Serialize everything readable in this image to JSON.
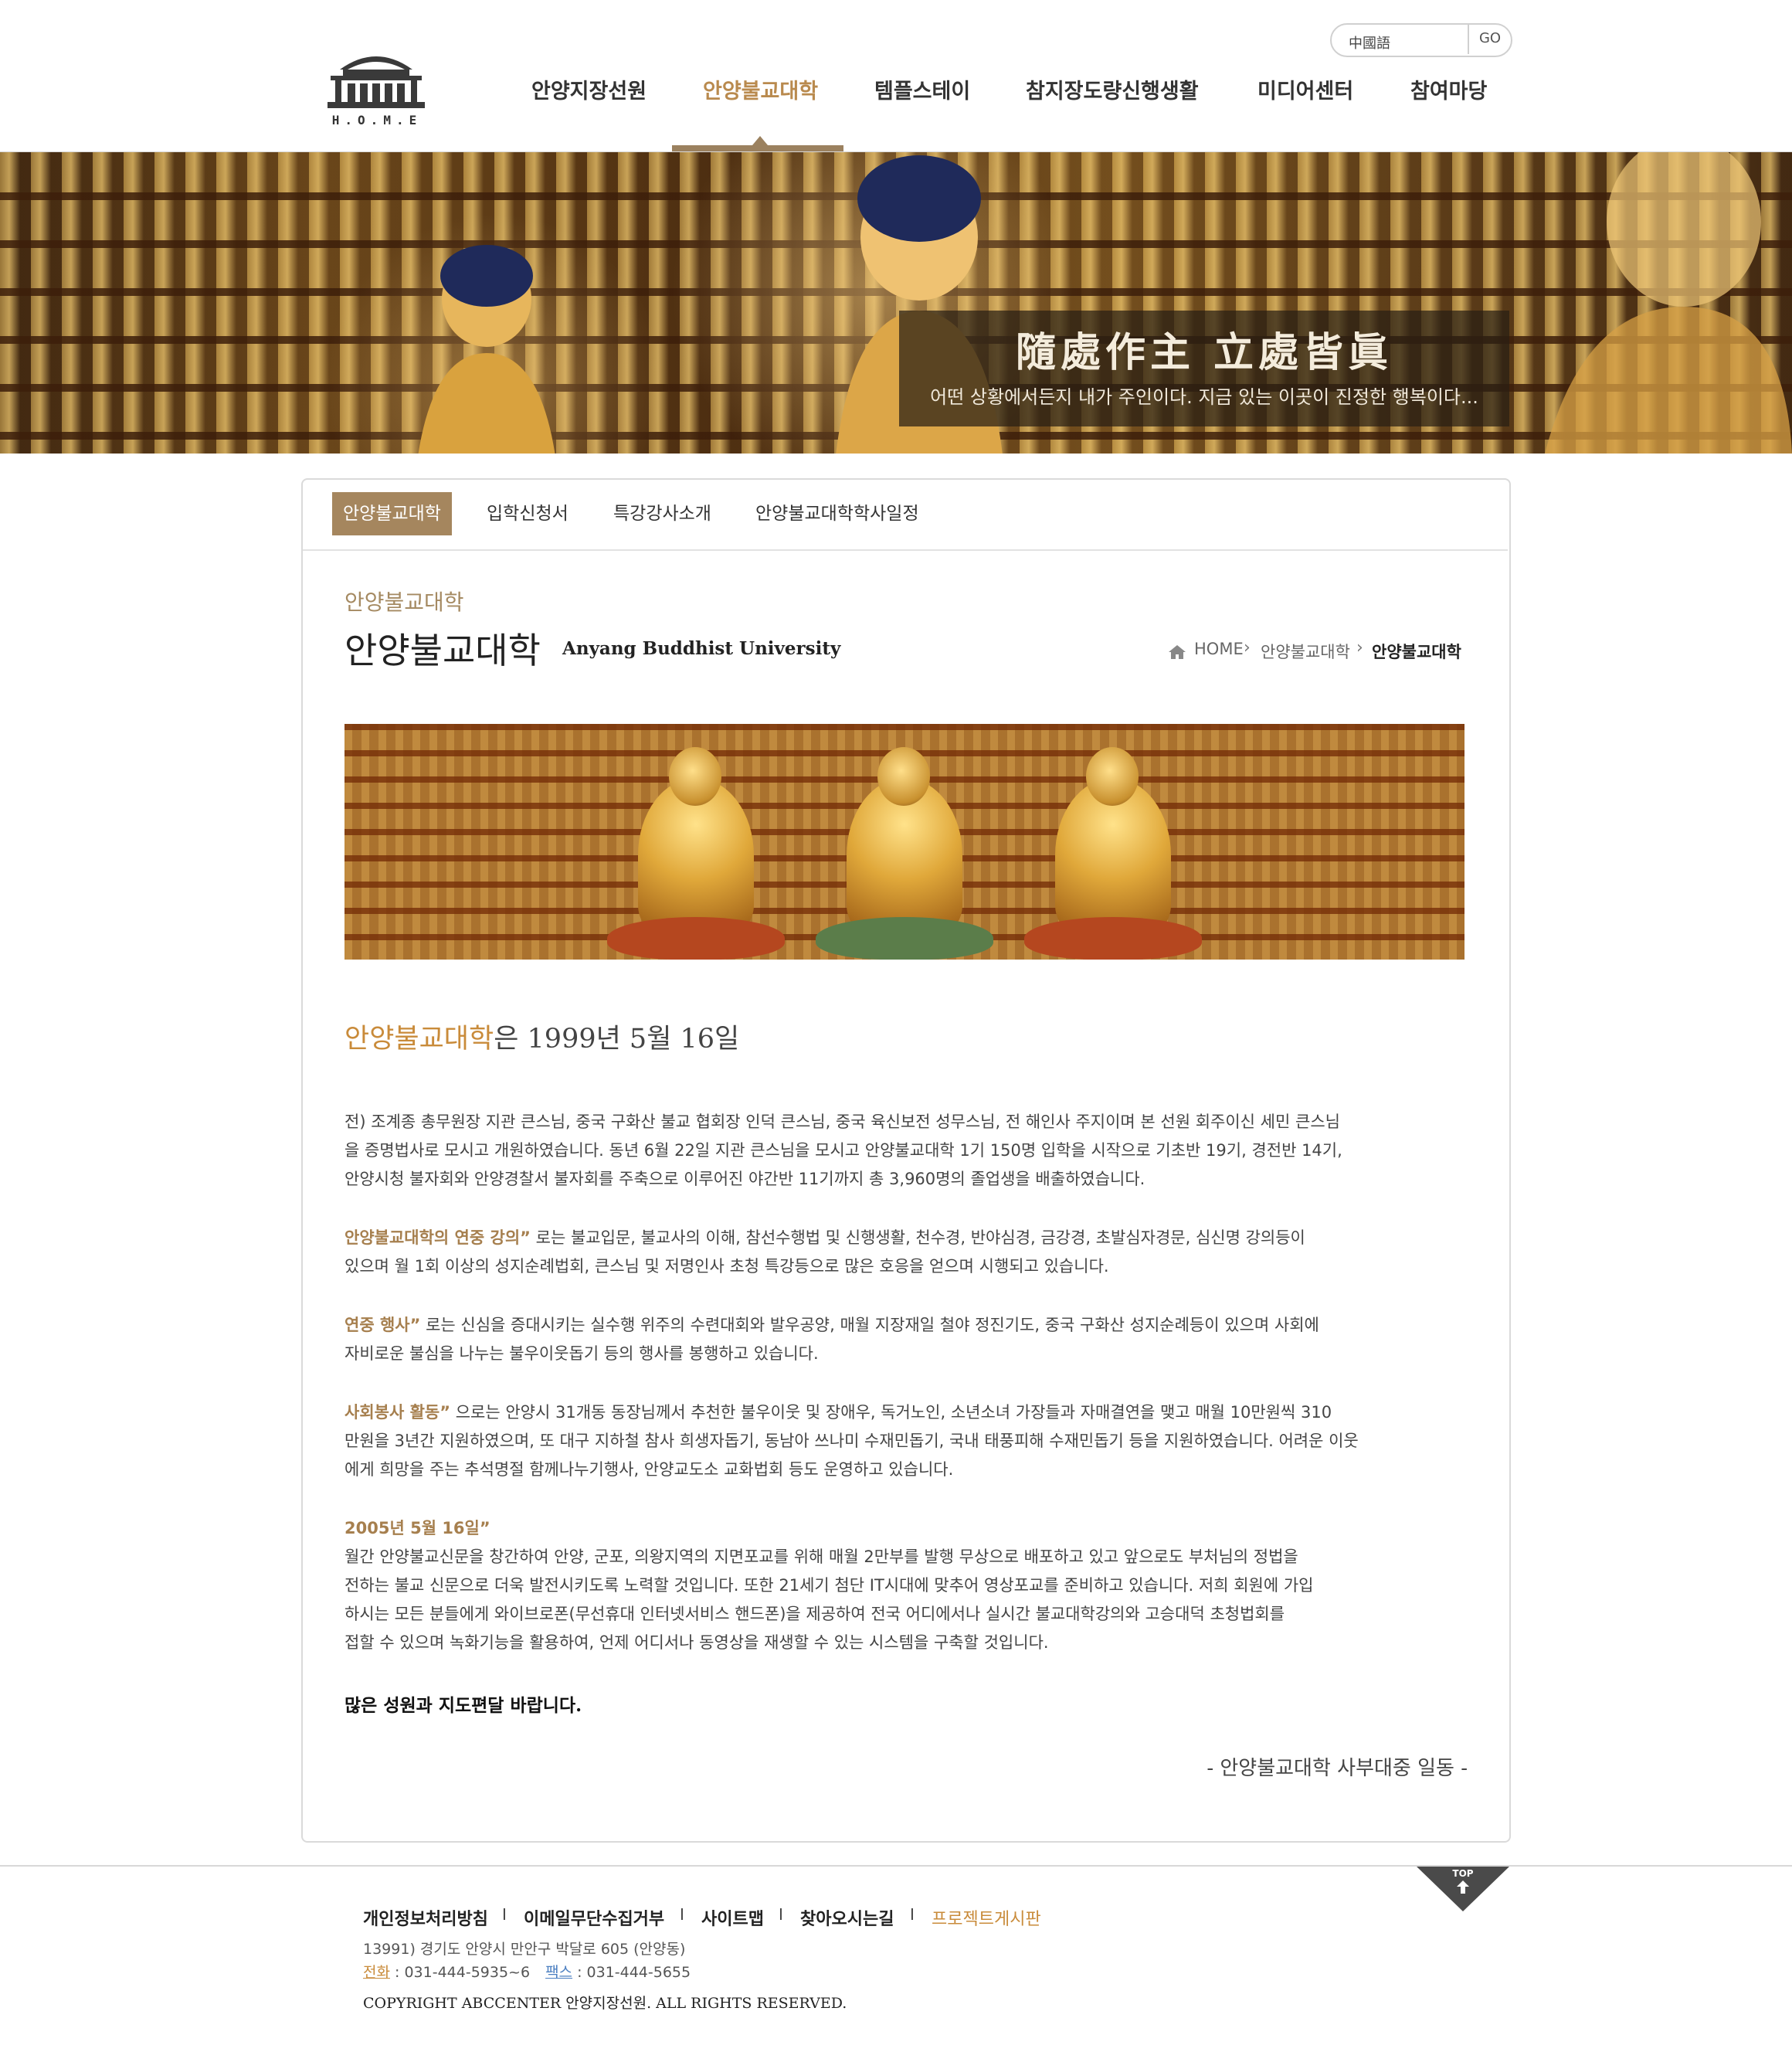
{
  "header": {
    "logo_text": "H.O.M.E",
    "language": {
      "value": "中國語",
      "go": "GO"
    },
    "nav": [
      {
        "label": "안양지장선원"
      },
      {
        "label": "안양불교대학"
      },
      {
        "label": "템플스테이"
      },
      {
        "label": "참지장도량신행생활"
      },
      {
        "label": "미디어센터"
      },
      {
        "label": "참여마당"
      }
    ]
  },
  "hero": {
    "hanja": "隨處作主 立處皆眞",
    "subtitle": "어떤 상황에서든지 내가 주인이다. 지금 있는 이곳이 진정한 행복이다..."
  },
  "subnav": {
    "tabs": [
      {
        "label": "안양불교대학"
      },
      {
        "label": "입학신청서"
      },
      {
        "label": "특강강사소개"
      },
      {
        "label": "안양불교대학학사일정"
      }
    ]
  },
  "page": {
    "section_label": "안양불교대학",
    "title": "안양불교대학",
    "subtitle": "Anyang Buddhist University",
    "breadcrumb": [
      "HOME",
      "안양불교대학",
      "안양불교대학"
    ]
  },
  "content": {
    "lead_highlight": "안양불교대학",
    "lead_rest": "은 1999년 5월 16일",
    "paragraphs": [
      {
        "highlight": "",
        "lines": [
          "전) 조계종 총무원장 지관 큰스님, 중국 구화산 불교 협회장 인덕 큰스님, 중국 육신보전 성무스님, 전 해인사 주지이며 본 선원 회주이신 세민 큰스님",
          "을 증명법사로 모시고 개원하였습니다. 동년 6월 22일 지관 큰스님을 모시고 안양불교대학 1기 150명 입학을 시작으로 기초반 19기, 경전반 14기,",
          "안양시청 불자회와 안양경찰서 불자회를 주축으로 이루어진 야간반 11기까지 총 3,960명의 졸업생을 배출하였습니다."
        ]
      },
      {
        "highlight": "안양불교대학의 연중 강의”",
        "lines": [
          " 로는 불교입문, 불교사의 이해, 참선수행법 및 신행생활, 천수경, 반야심경, 금강경, 초발심자경문, 심신명 강의등이",
          "있으며 월 1회 이상의 성지순례법회, 큰스님 및 저명인사 초청 특강등으로 많은 호응을 얻으며 시행되고 있습니다."
        ]
      },
      {
        "highlight": "연중 행사”",
        "lines": [
          " 로는 신심을 증대시키는 실수행 위주의 수련대회와 발우공양, 매월 지장재일 철야 정진기도, 중국 구화산 성지순례등이 있으며 사회에",
          "자비로운 불심을 나누는 불우이웃돕기 등의 행사를 봉행하고 있습니다."
        ]
      },
      {
        "highlight": "사회봉사 활동”",
        "lines": [
          " 으로는 안양시 31개동 동장님께서 추천한 불우이웃 및 장애우, 독거노인, 소년소녀 가장들과 자매결연을 맺고 매월 10만원씩 310",
          "만원을 3년간 지원하였으며, 또 대구 지하철 참사 희생자돕기, 동남아 쓰나미 수재민돕기, 국내 태풍피해 수재민돕기 등을 지원하였습니다. 어려운 이웃",
          "에게 희망을 주는 추석명절 함께나누기행사, 안양교도소 교화법회 등도 운영하고 있습니다."
        ]
      },
      {
        "highlight": "2005년 5월 16일”",
        "lines": [
          "월간 안양불교신문을 창간하여 안양, 군포, 의왕지역의 지면포교를 위해 매월 2만부를 발행 무상으로 배포하고 있고 앞으로도 부처님의 정법을",
          "전하는 불교 신문으로 더욱 발전시키도록 노력할 것입니다. 또한 21세기 첨단 IT시대에 맞추어 영상포교를 준비하고 있습니다. 저희 회원에 가입",
          "하시는 모든 분들에게 와이브로폰(무선휴대 인터넷서비스 핸드폰)을 제공하여 전국 어디에서나 실시간 불교대학강의와 고승대덕 초청법회를",
          "접할 수 있으며 녹화기능을 활용하여, 언제 어디서나 동영상을 재생할 수 있는 시스템을 구축할 것입니다."
        ]
      }
    ],
    "closing": "많은 성원과 지도편달 바랍니다.",
    "signature": "- 안양불교대학 사부대중 일동 -"
  },
  "footer": {
    "top_label": "TOP",
    "links": [
      {
        "label": "개인정보처리방침"
      },
      {
        "label": "이메일무단수집거부"
      },
      {
        "label": "사이트맵"
      },
      {
        "label": "찾아오시는길"
      },
      {
        "label": "프로젝트게시판"
      }
    ],
    "separator": "I",
    "address": "13991) 경기도 안양시 만안구 박달로 605 (안양동)",
    "tel_label": "전화",
    "tel": " : 031-444-5935~6",
    "fax_label": "팩스",
    "fax": " : 031-444-5655",
    "copyright": "COPYRIGHT ABCCENTER 안양지장선원. ALL RIGHTS RESERVED."
  },
  "colors": {
    "accent": "#c98b3a",
    "accent_muted": "#a5865e",
    "nav_bar": "#9b815f",
    "text": "#444444"
  }
}
